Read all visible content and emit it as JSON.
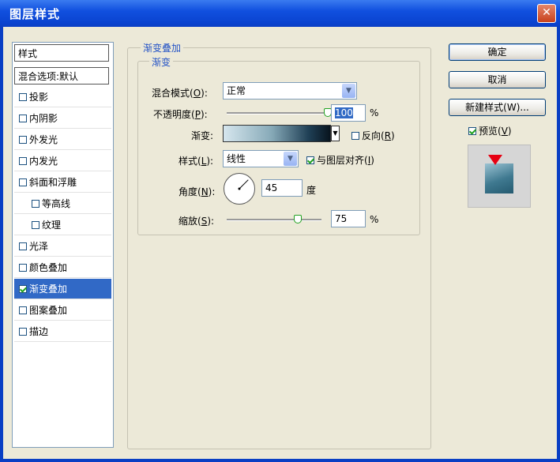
{
  "window": {
    "title": "图层样式",
    "close_symbol": "✕"
  },
  "sidebar": {
    "header": "样式",
    "blend_options": "混合选项:默认",
    "items": [
      {
        "label": "投影",
        "checked": false
      },
      {
        "label": "内阴影",
        "checked": false
      },
      {
        "label": "外发光",
        "checked": false
      },
      {
        "label": "内发光",
        "checked": false
      },
      {
        "label": "斜面和浮雕",
        "checked": false
      },
      {
        "label": "等高线",
        "checked": false
      },
      {
        "label": "纹理",
        "checked": false
      },
      {
        "label": "光泽",
        "checked": false
      },
      {
        "label": "颜色叠加",
        "checked": false
      },
      {
        "label": "渐变叠加",
        "checked": true,
        "selected": true
      },
      {
        "label": "图案叠加",
        "checked": false
      },
      {
        "label": "描边",
        "checked": false
      }
    ]
  },
  "panel": {
    "group_title": "渐变叠加",
    "subgroup_title": "渐变",
    "blend_mode": {
      "label": "混合模式(",
      "key": "O",
      "suffix": "):",
      "value": "正常"
    },
    "opacity": {
      "label": "不透明度(",
      "key": "P",
      "suffix": "):",
      "value": "100",
      "unit": "%",
      "level": 1.0
    },
    "gradient": {
      "label": "渐变:",
      "reverse_label": "反向(",
      "reverse_key": "R",
      "reverse_suffix": ")",
      "reverse_checked": false
    },
    "style": {
      "label": "样式(",
      "key": "L",
      "suffix": "):",
      "value": "线性",
      "align_label": "与图层对齐(",
      "align_key": "I",
      "align_suffix": ")",
      "align_checked": true
    },
    "angle": {
      "label": "角度(",
      "key": "N",
      "suffix": "):",
      "value": "45",
      "unit": "度"
    },
    "scale": {
      "label": "缩放(",
      "key": "S",
      "suffix": "):",
      "value": "75",
      "unit": "%",
      "level": 0.75
    }
  },
  "actions": {
    "ok": "确定",
    "cancel": "取消",
    "new_style": "新建样式(W)...",
    "preview_label": "预览(",
    "preview_key": "V",
    "preview_suffix": ")",
    "preview_checked": true
  },
  "colors": {
    "title_bar": "#0a3fc4",
    "selection": "#3169c6",
    "group_title": "#2453c6",
    "preview_marker": "#e60012"
  }
}
